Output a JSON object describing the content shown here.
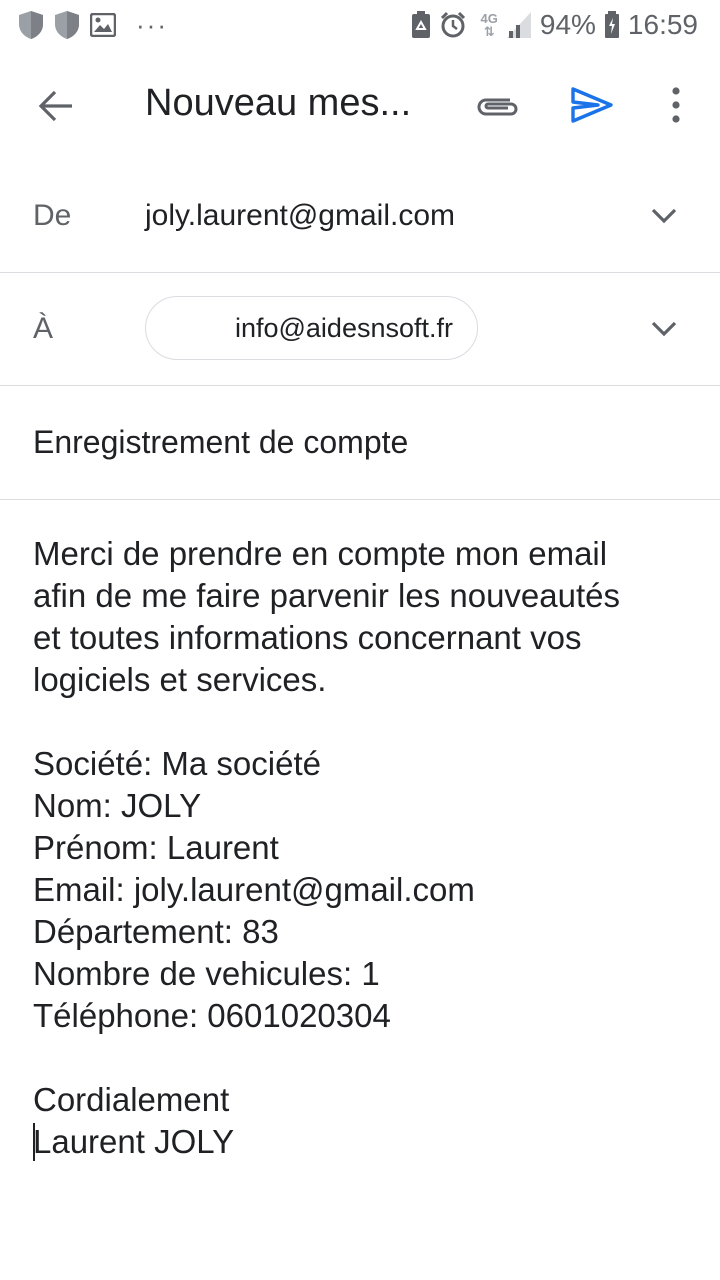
{
  "status_bar": {
    "icons": [
      "shield-icon",
      "shield-icon",
      "image-icon",
      "more-horizontal-icon",
      "recycle-icon",
      "alarm-icon",
      "network-4g-icon",
      "signal-icon",
      "battery-icon"
    ],
    "network": "4G",
    "battery": "94%",
    "time": "16:59",
    "dots": "···"
  },
  "app_bar": {
    "title": "Nouveau mes...",
    "icons": {
      "back": "arrow-back-icon",
      "attach": "attachment-icon",
      "send": "send-icon",
      "more": "more-vertical-icon"
    },
    "send_color": "#1a73e8"
  },
  "from": {
    "label": "De",
    "value": "joly.laurent@gmail.com"
  },
  "to": {
    "label": "À",
    "recipient": "info@aidesnsoft.fr"
  },
  "subject": "Enregistrement de compte",
  "body": {
    "intro": [
      "Merci de prendre en compte mon email",
      "afin de me faire parvenir les nouveautés",
      "et toutes informations concernant vos",
      "logiciels et services."
    ],
    "details": [
      "Société: Ma société",
      "Nom: JOLY",
      "Prénom: Laurent",
      "Email: joly.laurent@gmail.com",
      "Département: 83",
      "Nombre de vehicules: 1",
      "Téléphone: 0601020304"
    ],
    "closing": "Cordialement",
    "signature": "Laurent JOLY"
  }
}
